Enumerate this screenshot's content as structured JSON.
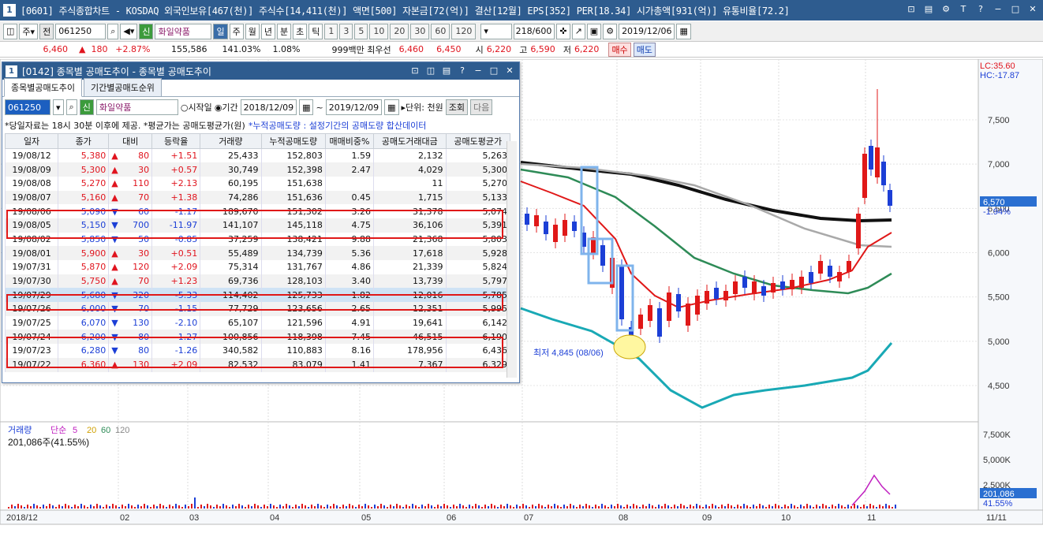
{
  "window": {
    "num": "1",
    "title": "[0601] 주식종합차트 - KOSDAQ 외국인보유[467(천)] 주식수[14,411(천)] 액면[500] 자본금[72(억)] 결산[12월] EPS[352] PER[18.34] 시가총액[931(억)] 유통비율[72.2]"
  },
  "toolbar": {
    "code": "061250",
    "badge": "신",
    "name": "화일약품",
    "periods": [
      "일",
      "주",
      "월",
      "년",
      "분",
      "초",
      "틱"
    ],
    "intervals": [
      "1",
      "3",
      "5",
      "10",
      "20",
      "30",
      "60",
      "120"
    ],
    "count": "218/600",
    "date": "2019/12/06"
  },
  "quote": {
    "price": "6,460",
    "arrow": "▲",
    "change": "180",
    "rate": "+2.87%",
    "volume": "155,586",
    "vol_ratio": "141.03%",
    "turnover": "1.08%",
    "bid_label": "999백만 최우선",
    "ask": "6,460",
    "bid": "6,450",
    "open_label": "시",
    "open": "6,220",
    "high_label": "고",
    "high": "6,590",
    "low_label": "저",
    "low": "6,220",
    "buy": "매수",
    "sell": "매도"
  },
  "sub": {
    "num": "1",
    "title": "[0142] 종목별 공매도추이 - 종목별 공매도추이",
    "tabs": [
      "종목별공매도추이",
      "기간별공매도순위"
    ],
    "code": "061250",
    "badge": "신",
    "name": "화일약품",
    "radio1": "시작일",
    "radio2": "기간",
    "from": "2018/12/09",
    "tilde": "~",
    "to": "2019/12/09",
    "unit": "▸단위: 천원",
    "query": "조회",
    "next": "다음",
    "note1": "*당일자료는 18시 30분 이후에 제공. *평균가는 공매도평균가(원)",
    "note2": "*누적공매도량 : 설정기간의 공매도량 합산데이터"
  },
  "columns": [
    "일자",
    "종가",
    "대비",
    "등락율",
    "거래량",
    "누적공매도량",
    "매매비중%",
    "공매도거래대금",
    "공매도평균가"
  ],
  "rows": [
    [
      "19/08/12",
      "5,380",
      "▲",
      "80",
      "+1.51",
      "25,433",
      "152,803",
      "1.59",
      "2,132",
      "5,263"
    ],
    [
      "19/08/09",
      "5,300",
      "▲",
      "30",
      "+0.57",
      "30,749",
      "152,398",
      "2.47",
      "4,029",
      "5,300"
    ],
    [
      "19/08/08",
      "5,270",
      "▲",
      "110",
      "+2.13",
      "60,195",
      "151,638",
      "",
      "11",
      "5,270"
    ],
    [
      "19/08/07",
      "5,160",
      "▲",
      "70",
      "+1.38",
      "74,286",
      "151,636",
      "0.45",
      "1,715",
      "5,133"
    ],
    [
      "19/08/06",
      "5,090",
      "▼",
      "60",
      "-1.17",
      "189,670",
      "151,302",
      "3.26",
      "31,378",
      "5,074"
    ],
    [
      "19/08/05",
      "5,150",
      "▼",
      "700",
      "-11.97",
      "141,107",
      "145,118",
      "4.75",
      "36,106",
      "5,391"
    ],
    [
      "19/08/02",
      "5,850",
      "▼",
      "50",
      "-0.85",
      "37,259",
      "138,421",
      "9.88",
      "21,368",
      "5,803"
    ],
    [
      "19/08/01",
      "5,900",
      "▲",
      "30",
      "+0.51",
      "55,489",
      "134,739",
      "5.36",
      "17,618",
      "5,928"
    ],
    [
      "19/07/31",
      "5,870",
      "▲",
      "120",
      "+2.09",
      "75,314",
      "131,767",
      "4.86",
      "21,339",
      "5,824"
    ],
    [
      "19/07/30",
      "5,750",
      "▲",
      "70",
      "+1.23",
      "69,736",
      "128,103",
      "3.40",
      "13,739",
      "5,797"
    ],
    [
      "19/07/29",
      "5,680",
      "▼",
      "320",
      "-5.33",
      "114,402",
      "125,733",
      "1.82",
      "12,016",
      "5,785"
    ],
    [
      "19/07/26",
      "6,000",
      "▼",
      "70",
      "-1.15",
      "77,729",
      "123,656",
      "2.65",
      "12,351",
      "5,995"
    ],
    [
      "19/07/25",
      "6,070",
      "▼",
      "130",
      "-2.10",
      "65,107",
      "121,596",
      "4.91",
      "19,641",
      "6,142"
    ],
    [
      "19/07/24",
      "6,200",
      "▼",
      "80",
      "-1.27",
      "100,856",
      "118,398",
      "7.45",
      "46,515",
      "6,190"
    ],
    [
      "19/07/23",
      "6,280",
      "▼",
      "80",
      "-1.26",
      "340,582",
      "110,883",
      "8.16",
      "178,956",
      "6,436"
    ],
    [
      "19/07/22",
      "6,360",
      "▲",
      "130",
      "+2.09",
      "82,532",
      "83,079",
      "1.41",
      "7,367",
      "6,329"
    ]
  ],
  "chart": {
    "lc": "LC:35.60",
    "hc": "HC:-17.87",
    "yticks": [
      "7,500",
      "7,000",
      "6,500",
      "6,000",
      "5,500",
      "5,000",
      "4,500"
    ],
    "last_price": "6,570",
    "last_rate": "-1.94%",
    "low_label": "최저 4,845 (08/06)",
    "vol_label": "거래량",
    "ma_label": "단순",
    "ma": [
      "5",
      "20",
      "60",
      "120"
    ],
    "vol_value": "201,086주(41.55%)",
    "vol_yticks": [
      "7,500K",
      "5,000K",
      "2,500K"
    ],
    "vol_last": "201,086",
    "vol_pct": "41.55%",
    "xticks": [
      "2018/12",
      "02",
      "03",
      "04",
      "05",
      "06",
      "07",
      "08",
      "09",
      "10",
      "11",
      "11/11"
    ]
  }
}
